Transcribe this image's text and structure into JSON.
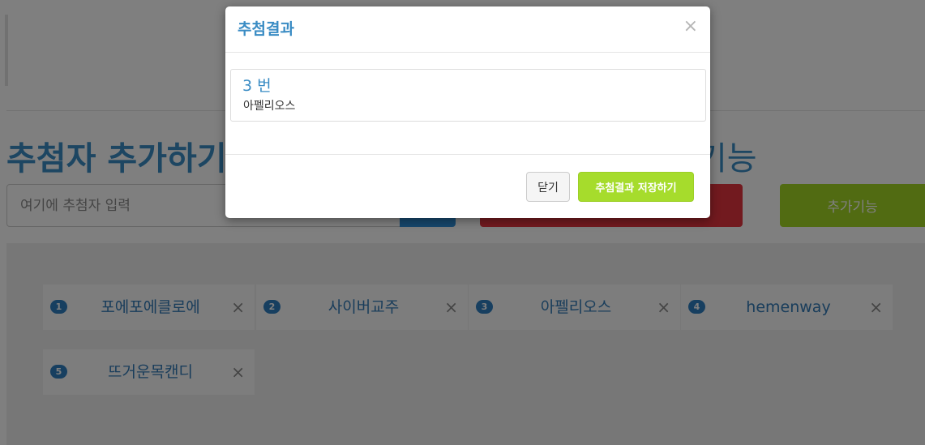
{
  "page": {
    "title": "추첨자 추가하기",
    "title_right": "기능",
    "input_placeholder": "여기에 추첨자 입력",
    "extra_button_label": "추가기능"
  },
  "entries": [
    {
      "number": "1",
      "name": "포에포에클로에",
      "remove_icon": "×"
    },
    {
      "number": "2",
      "name": "사이버교주",
      "remove_icon": "×"
    },
    {
      "number": "3",
      "name": "아펠리오스",
      "remove_icon": "×"
    },
    {
      "number": "4",
      "name": "hemenway",
      "remove_icon": "×"
    },
    {
      "number": "5",
      "name": "뜨거운목캔디",
      "remove_icon": "×"
    }
  ],
  "modal": {
    "title": "추첨결과",
    "close_icon": "×",
    "result_number": "3 번",
    "result_name": "아펠리오스",
    "close_button": "닫기",
    "save_button": "추첨결과 저장하기"
  },
  "colors": {
    "accent_blue": "#3a8cc4",
    "danger_red": "#e5343f",
    "success_green": "#a6dc2c"
  }
}
